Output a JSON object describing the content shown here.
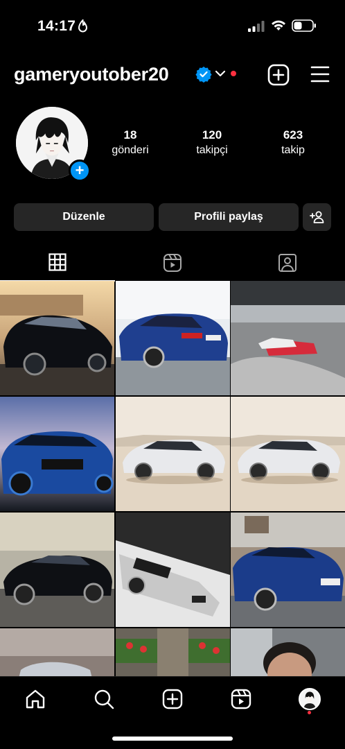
{
  "status_bar": {
    "time": "14:17",
    "icons": [
      "hotspot-icon",
      "signal-icon",
      "wifi-icon",
      "battery-icon"
    ]
  },
  "header": {
    "username": "gameryoutober20",
    "icons": [
      "verified-badge-icon",
      "chevron-down-icon",
      "new-post-icon",
      "menu-icon"
    ],
    "notification_dot_color": "#ff3040"
  },
  "profile": {
    "stats": [
      {
        "value": "18",
        "label": "gönderi"
      },
      {
        "value": "120",
        "label": "takipçi"
      },
      {
        "value": "623",
        "label": "takip"
      }
    ],
    "add_story_label": "+"
  },
  "actions": {
    "edit_label": "Düzenle",
    "share_label": "Profili paylaş",
    "discover_icon": "add-person-icon"
  },
  "tabs": [
    {
      "icon": "grid-icon",
      "active": true
    },
    {
      "icon": "reels-icon",
      "active": false
    },
    {
      "icon": "tagged-icon",
      "active": false
    }
  ],
  "posts": [
    {
      "subject": "black bmw sedan at sunset"
    },
    {
      "subject": "blue bmw coupe rear view"
    },
    {
      "subject": "drift cars on track"
    },
    {
      "subject": "blue ford mustang widebody"
    },
    {
      "subject": "white dodge charger"
    },
    {
      "subject": "white dodge charger"
    },
    {
      "subject": "black bmw coupe"
    },
    {
      "subject": "silver bmw sedan tilted"
    },
    {
      "subject": "blue bmw coupe street"
    },
    {
      "subject": "car in motion"
    },
    {
      "subject": "building with flowers"
    },
    {
      "subject": "person selfie"
    }
  ],
  "bottom_nav": [
    "home-icon",
    "search-icon",
    "create-icon",
    "reels-icon",
    "profile-avatar"
  ],
  "colors": {
    "background": "#000000",
    "button": "#262626",
    "accent_blue": "#0095f6",
    "notification_red": "#ff3040"
  }
}
